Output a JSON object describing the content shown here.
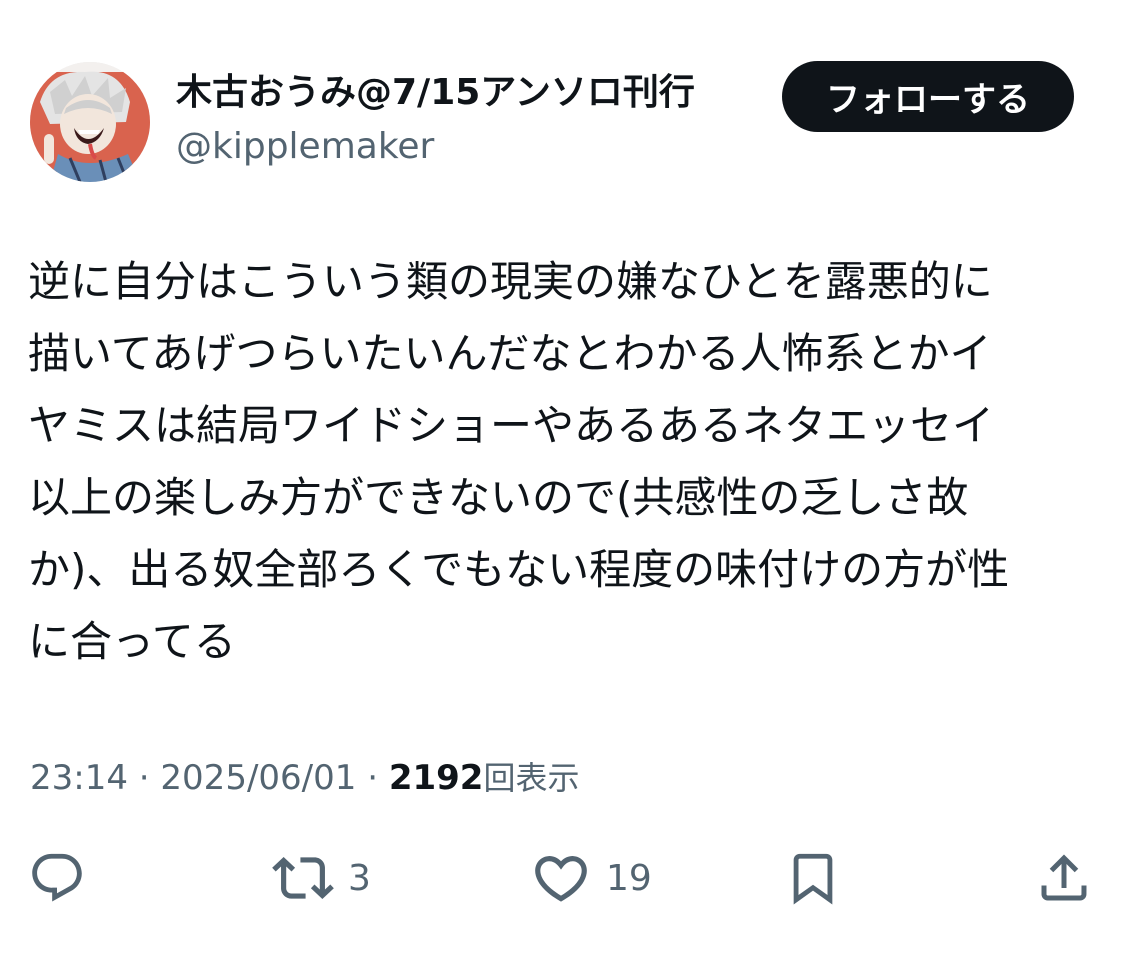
{
  "tweet": {
    "author": {
      "display_name": "木古おうみ@7/15アンソロ刊行",
      "handle": "@kipplemaker"
    },
    "follow_label": "フォローする",
    "text_lines": [
      "逆に自分はこういう類の現実の嫌なひとを露悪的に",
      "描いてあげつらいたいんだなとわかる人怖系とかイ",
      "ヤミスは結局ワイドショーやあるあるネタエッセイ",
      "以上の楽しみ方ができないので(共感性の乏しさ故",
      "か)、出る奴全部ろくでもない程度の味付けの方が性",
      "に合ってる"
    ],
    "time": "23:14",
    "separator": "·",
    "date": "2025/06/01",
    "views_count": "2192",
    "views_label": "回表示",
    "actions": {
      "reply": {
        "icon": "reply-icon"
      },
      "retweet": {
        "icon": "retweet-icon",
        "count": "3"
      },
      "like": {
        "icon": "heart-icon",
        "count": "19"
      },
      "bookmark": {
        "icon": "bookmark-icon"
      },
      "share": {
        "icon": "share-icon"
      }
    },
    "colors": {
      "text": "#0f1419",
      "secondary": "#536471",
      "follow_button_bg": "#0f1419",
      "follow_button_text": "#ffffff"
    }
  }
}
